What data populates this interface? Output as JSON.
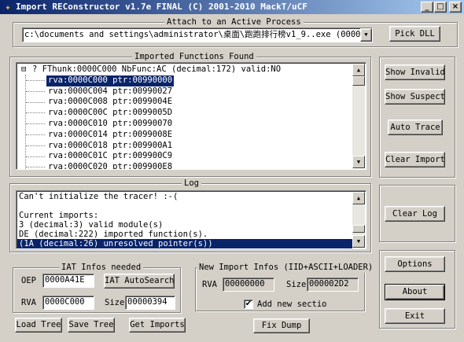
{
  "window": {
    "title": "Import REConstructor v1.7e FINAL (C) 2001-2010 MackT/uCF",
    "minimize": "_",
    "maximize": "□",
    "close": "×"
  },
  "attach": {
    "group_label": "Attach to an Active Process",
    "process_value": "c:\\documents and settings\\administrator\\桌面\\跑跑排行榜v1_9..exe (00000",
    "pick_dll": "Pick DLL"
  },
  "imports": {
    "group_label": "Imported Functions Found",
    "expander": "⊟",
    "thunk": "? FThunk:0000C000 NbFunc:AC (decimal:172) valid:NO",
    "items": [
      "rva:0000C000 ptr:00990000",
      "rva:0000C004 ptr:00990027",
      "rva:0000C008 ptr:0099004E",
      "rva:0000C00C ptr:0099005D",
      "rva:0000C010 ptr:00990070",
      "rva:0000C014 ptr:0099008E",
      "rva:0000C018 ptr:009900A1",
      "rva:0000C01C ptr:009900C9",
      "rva:0000C020 ptr:009900E8"
    ],
    "selected_index": 0
  },
  "right_buttons": {
    "show_invalid": "Show Invalid",
    "show_suspect": "Show Suspect",
    "auto_trace": "Auto Trace",
    "clear_imports": "Clear Imports",
    "clear_log": "Clear Log",
    "options": "Options",
    "about": "About",
    "exit": "Exit"
  },
  "log": {
    "group_label": "Log",
    "lines": [
      "Can't initialize the tracer! :-(",
      "",
      "Current imports:",
      "3 (decimal:3) valid module(s)",
      "DE (decimal:222) imported function(s).",
      "(1A (decimal:26) unresolved pointer(s))"
    ],
    "selected_index": 5
  },
  "iat": {
    "group_label": "IAT Infos needed",
    "oep_label": "OEP",
    "oep_value": "0000A41E",
    "autosearch": "IAT AutoSearch",
    "rva_label": "RVA",
    "rva_value": "0000C000",
    "size_label": "Size",
    "size_value": "00000394"
  },
  "new_import": {
    "group_label": "New Import Infos (IID+ASCII+LOADER)",
    "rva_label": "RVA",
    "rva_value": "00000000",
    "size_label": "Size",
    "size_value": "000002D2",
    "add_section_label": "Add new sectio",
    "add_section_checked": true,
    "check_mark": "✔"
  },
  "bottom": {
    "load_tree": "Load Tree",
    "save_tree": "Save Tree",
    "get_imports": "Get Imports",
    "fix_dump": "Fix Dump"
  },
  "scroll_arrows": {
    "up": "▲",
    "down": "▼"
  }
}
